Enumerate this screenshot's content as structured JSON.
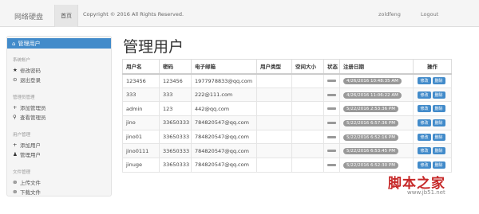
{
  "navbar": {
    "brand": "网络硬盘",
    "active_item": "首页",
    "copyright": "Copyright © 2016 All Rights Reserved.",
    "username": "zoldfeng",
    "logout": "Logout"
  },
  "sidebar": {
    "active": {
      "icon": "home-icon",
      "label": "管理用户"
    },
    "sections": [
      {
        "header": "系统帐户",
        "items": [
          {
            "icon": "star-icon",
            "label": "修改密码"
          },
          {
            "icon": "logout-icon",
            "label": "退出登录"
          }
        ]
      },
      {
        "header": "管理员管理",
        "items": [
          {
            "icon": "plus-icon",
            "label": "添加管理员"
          },
          {
            "icon": "search-icon",
            "label": "查看管理员"
          }
        ]
      },
      {
        "header": "用户管理",
        "items": [
          {
            "icon": "plus-icon",
            "label": "添加用户"
          },
          {
            "icon": "user-icon",
            "label": "管理用户"
          }
        ]
      },
      {
        "header": "文件管理",
        "items": [
          {
            "icon": "upload-icon",
            "label": "上传文件"
          },
          {
            "icon": "download-icon",
            "label": "下载文件"
          }
        ]
      }
    ]
  },
  "main": {
    "title": "管理用户",
    "table": {
      "columns": [
        "用户名",
        "密码",
        "电子邮箱",
        "用户类型",
        "空间大小",
        "状态",
        "注册日期",
        "操作"
      ],
      "rows": [
        {
          "username": "123456",
          "password": "123456",
          "email": "1977978833@qq.com",
          "date": "4/26/2016 10:48:35 AM"
        },
        {
          "username": "333",
          "password": "333",
          "email": "222@111.com",
          "date": "4/26/2016 11:06:22 AM"
        },
        {
          "username": "admin",
          "password": "123",
          "email": "442@qq.com",
          "date": "5/22/2016 2:53:36 PM"
        },
        {
          "username": "jino",
          "password": "33650333",
          "email": "784820547@qq.com",
          "date": "5/22/2016 6:57:36 PM"
        },
        {
          "username": "jino01",
          "password": "33650333",
          "email": "784820547@qq.com",
          "date": "5/22/2016 6:52:16 PM"
        },
        {
          "username": "jino0111",
          "password": "33650333",
          "email": "784820547@qq.com",
          "date": "5/22/2016 6:53:45 PM"
        },
        {
          "username": "jinuge",
          "password": "33650333",
          "email": "784820547@qq.com",
          "date": "5/22/2016 6:52:30 PM"
        }
      ],
      "btn_edit": "修改",
      "btn_delete": "删除"
    }
  },
  "watermark": {
    "text": "脚本之家",
    "url": "www.jb51.net"
  }
}
